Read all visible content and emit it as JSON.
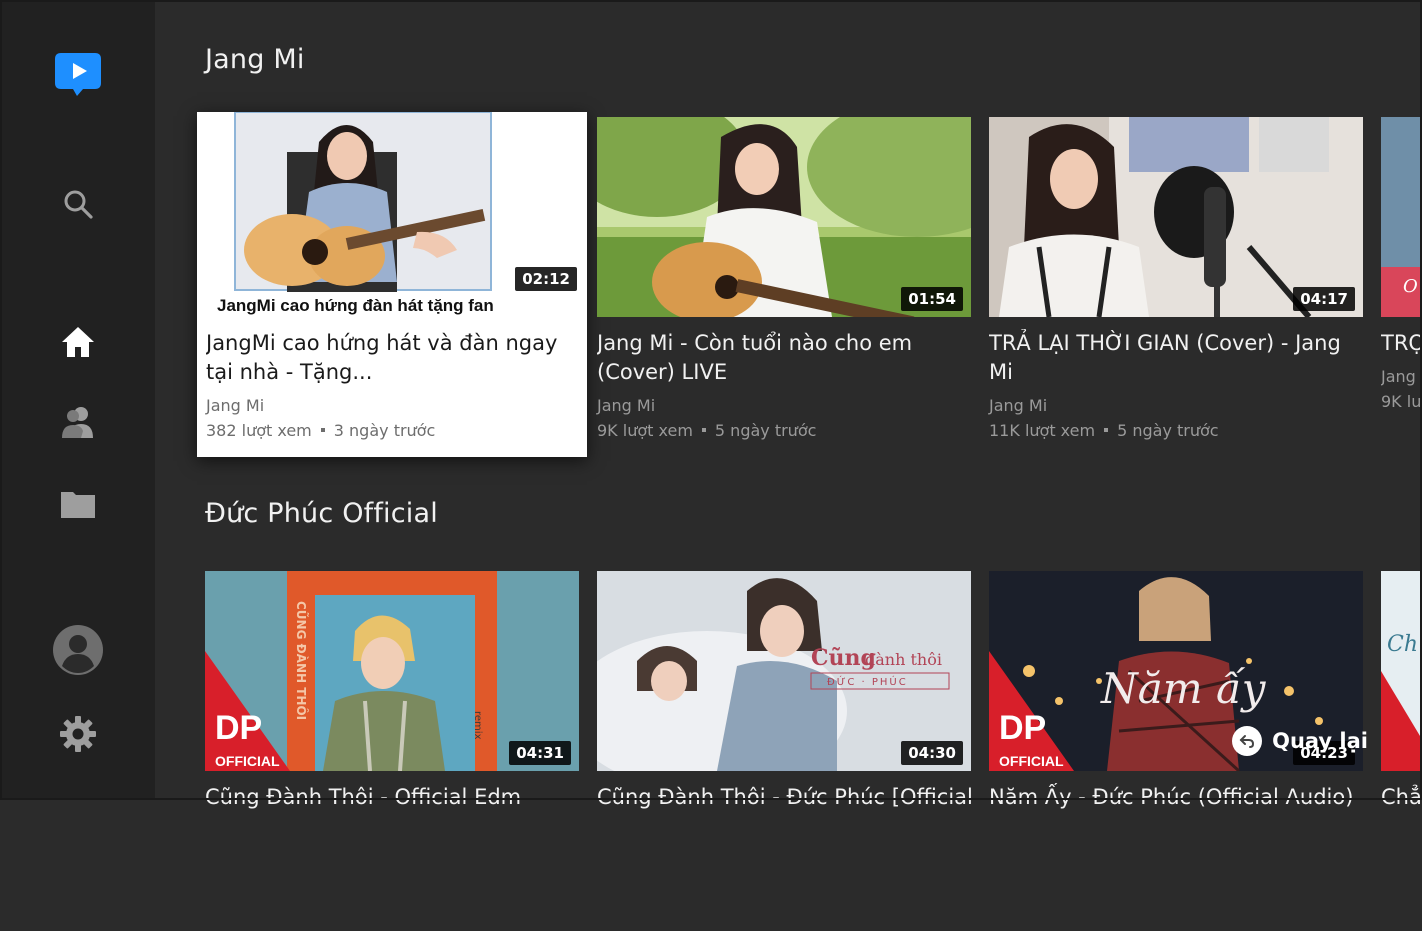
{
  "app": {
    "sidebar": {
      "logo_icon": "youtube-play-logo-icon",
      "items": [
        {
          "name": "search",
          "icon": "search-icon"
        },
        {
          "name": "home",
          "icon": "home-icon",
          "active": true
        },
        {
          "name": "subscriptions",
          "icon": "subscriptions-icon"
        },
        {
          "name": "library",
          "icon": "folder-icon"
        },
        {
          "name": "account",
          "icon": "avatar-icon"
        },
        {
          "name": "settings",
          "icon": "gear-icon"
        }
      ]
    },
    "colors": {
      "accent": "#1e90ff",
      "background": "#2b2b2b",
      "sidebar": "#212121",
      "focus_card": "#ffffff"
    }
  },
  "sections": [
    {
      "title": "Jang Mi",
      "videos": [
        {
          "title": "JangMi cao hứng hát và đàn ngay tại nhà - Tặng...",
          "channel": "Jang Mi",
          "views": "382 lượt xem",
          "age": "3 ngày trước",
          "duration": "02:12",
          "thumb_caption": "JangMi cao hứng đàn hát tặng fan"
        },
        {
          "title": "Jang Mi - Còn tuổi nào cho em (Cover) LIVE",
          "channel": "Jang Mi",
          "views": "9K lượt xem",
          "age": "5 ngày trước",
          "duration": "01:54"
        },
        {
          "title": "TRẢ LẠI THỜI GIAN (Cover) - Jang Mi",
          "channel": "Jang Mi",
          "views": "11K lượt xem",
          "age": "5 ngày trước",
          "duration": "04:17"
        },
        {
          "title": "TRỌ",
          "channel": "Jang",
          "views": "9K lư",
          "age": "",
          "duration": "",
          "thumb_caption": "O"
        }
      ]
    },
    {
      "title": "Đức Phúc Official",
      "videos": [
        {
          "title": "Cũng Đành Thôi - Official Edm",
          "duration": "04:31",
          "thumb_caption_1": "DP",
          "thumb_caption_2": "OFFICIAL",
          "thumb_caption_3": "CŨNG ĐÀNH THÔI",
          "thumb_caption_4": "remix"
        },
        {
          "title": "Cũng Đành Thôi - Đức Phúc [Official",
          "duration": "04:30",
          "thumb_caption_1": "Cũng",
          "thumb_caption_2": "đành thôi",
          "thumb_caption_3": "ĐỨC · PHÚC"
        },
        {
          "title": "Năm Ấy - Đức Phúc (Official Audio)",
          "duration": "04:23",
          "thumb_caption_1": "DP",
          "thumb_caption_2": "OFFICIAL",
          "thumb_caption_3": "Năm ấy"
        },
        {
          "title": "Chẳ",
          "duration": "",
          "thumb_caption_1": "Ch"
        }
      ]
    }
  ],
  "back_hint": {
    "label": "Quay lại",
    "icon": "back-arrow-icon"
  }
}
